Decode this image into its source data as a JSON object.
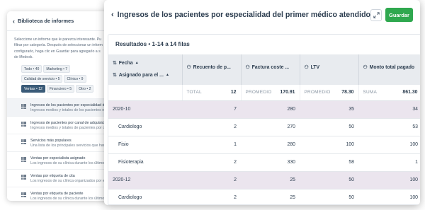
{
  "library": {
    "title": "Biblioteca de informes",
    "description": [
      "Seleccione un informe que le parezca interesante. Pu",
      "filtrar por categoría. Después de seleccionar un inform",
      "configurarlo, haga clic en Guardar para agregarlo a s",
      "de Medesk."
    ],
    "chips": [
      {
        "label": "Todo • 40",
        "active": false
      },
      {
        "label": "Marketing • 7",
        "active": false
      },
      {
        "label": "Calidad de servicio • 5",
        "active": false
      },
      {
        "label": "Clínico • 9",
        "active": false
      },
      {
        "label": "Ventas • 12",
        "active": true
      },
      {
        "label": "Financiero • 5",
        "active": false
      },
      {
        "label": "Otro • 2",
        "active": false
      }
    ],
    "items": [
      {
        "title": "Ingresos de los pacientes por especialidad del p",
        "subtitle": "Ingresos medios y totales de los pacientes en e",
        "selected": true
      },
      {
        "title": "Ingresos de pacientes por canal de adquisición",
        "subtitle": "Ingresos medios y totales de pacientes por can",
        "selected": false
      },
      {
        "title": "Servicios más populares",
        "subtitle": "Una lista de los principales servicios que han g",
        "selected": false
      },
      {
        "title": "Ventas por especialista asignado",
        "subtitle": "Los ingresos de su clínica durante los últimos t",
        "selected": false
      },
      {
        "title": "Ventas por etiqueta de cita",
        "subtitle": "Los ingresos de su clínica organizados por etiq",
        "selected": false
      },
      {
        "title": "Ventas por etiqueta de paciente",
        "subtitle": "Los ingresos de su clínica durante los últimos t",
        "selected": false
      }
    ]
  },
  "report": {
    "title": "Ingresos de los pacientes por especialidad del primer médico atendido",
    "save_label": "Guardar",
    "results_label": "Resultados • 1-14 a 14 filas",
    "columns": {
      "fecha": "Fecha",
      "asignado": "Asignado para el ...",
      "recuento": "Recuento de p...",
      "factura": "Factura coste ...",
      "ltv": "LTV",
      "monto": "Monto total pagado"
    },
    "totals": {
      "total_label": "TOTAL",
      "total_value": "12",
      "promedio_label": "PROMEDIO",
      "factura_value": "170.91",
      "ltv_label": "PROMEDIO",
      "ltv_value": "78.30",
      "suma_label": "SUMA",
      "monto_value": "861.30"
    },
    "rows": [
      {
        "label": "2020-10",
        "recuento": "7",
        "factura": "280",
        "ltv": "35",
        "monto": "34",
        "group": true
      },
      {
        "label": "Cardiologo",
        "recuento": "2",
        "factura": "270",
        "ltv": "50",
        "monto": "53",
        "group": false
      },
      {
        "label": "Fisio",
        "recuento": "1",
        "factura": "280",
        "ltv": "100",
        "monto": "100",
        "group": false
      },
      {
        "label": "Fisioterapia",
        "recuento": "2",
        "factura": "330",
        "ltv": "58",
        "monto": "1",
        "group": false
      },
      {
        "label": "2020-12",
        "recuento": "2",
        "factura": "25",
        "ltv": "50",
        "monto": "100",
        "group": true
      },
      {
        "label": "Cardiologo",
        "recuento": "2",
        "factura": "25",
        "ltv": "50",
        "monto": "100",
        "group": false
      }
    ]
  },
  "icons": {
    "expand": "expand-icon",
    "back": "chevron-left-icon",
    "column": "person-icon",
    "table": "table-icon"
  },
  "colors": {
    "save": "#2fa84f",
    "chip_active": "#3a5b78",
    "group_row": "#ebe5ee",
    "header_bg": "#e8ebef"
  }
}
